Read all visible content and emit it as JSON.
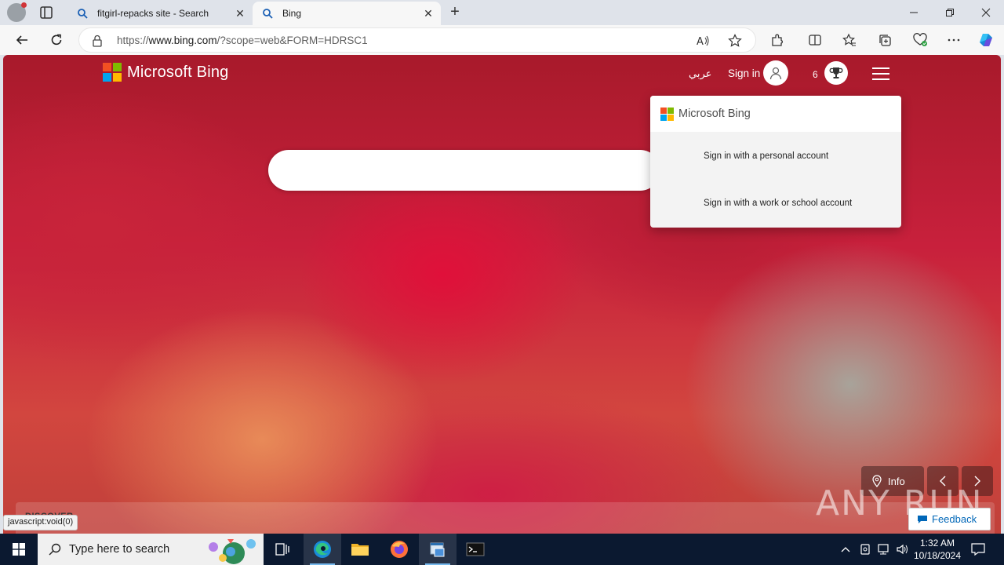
{
  "browser": {
    "tabs": [
      {
        "title": "fitgirl-repacks site - Search",
        "active": false
      },
      {
        "title": "Bing",
        "active": true
      }
    ],
    "address": {
      "url_prefix": "https://",
      "url_host": "www.bing.com",
      "url_rest": "/?scope=web&FORM=HDRSC1"
    },
    "status_text": "javascript:void(0)"
  },
  "bing": {
    "logo_text": "Microsoft Bing",
    "language_link": "عربي",
    "signin_label": "Sign in",
    "rewards_count": "6",
    "flyout": {
      "header": "Microsoft Bing",
      "personal": "Sign in with a personal account",
      "work": "Sign in with a work or school account"
    },
    "info_label": "Info",
    "discover_label": "DISCOVER",
    "feedback_label": "Feedback",
    "watermark": "ANY RUN"
  },
  "taskbar": {
    "search_placeholder": "Type here to search",
    "time": "1:32 AM",
    "date": "10/18/2024"
  },
  "colors": {
    "ms_red": "#f25022",
    "ms_green": "#7fba00",
    "ms_blue": "#00a4ef",
    "ms_yellow": "#ffb900",
    "taskbar": "#0b1930",
    "feedback": "#0067b8"
  }
}
